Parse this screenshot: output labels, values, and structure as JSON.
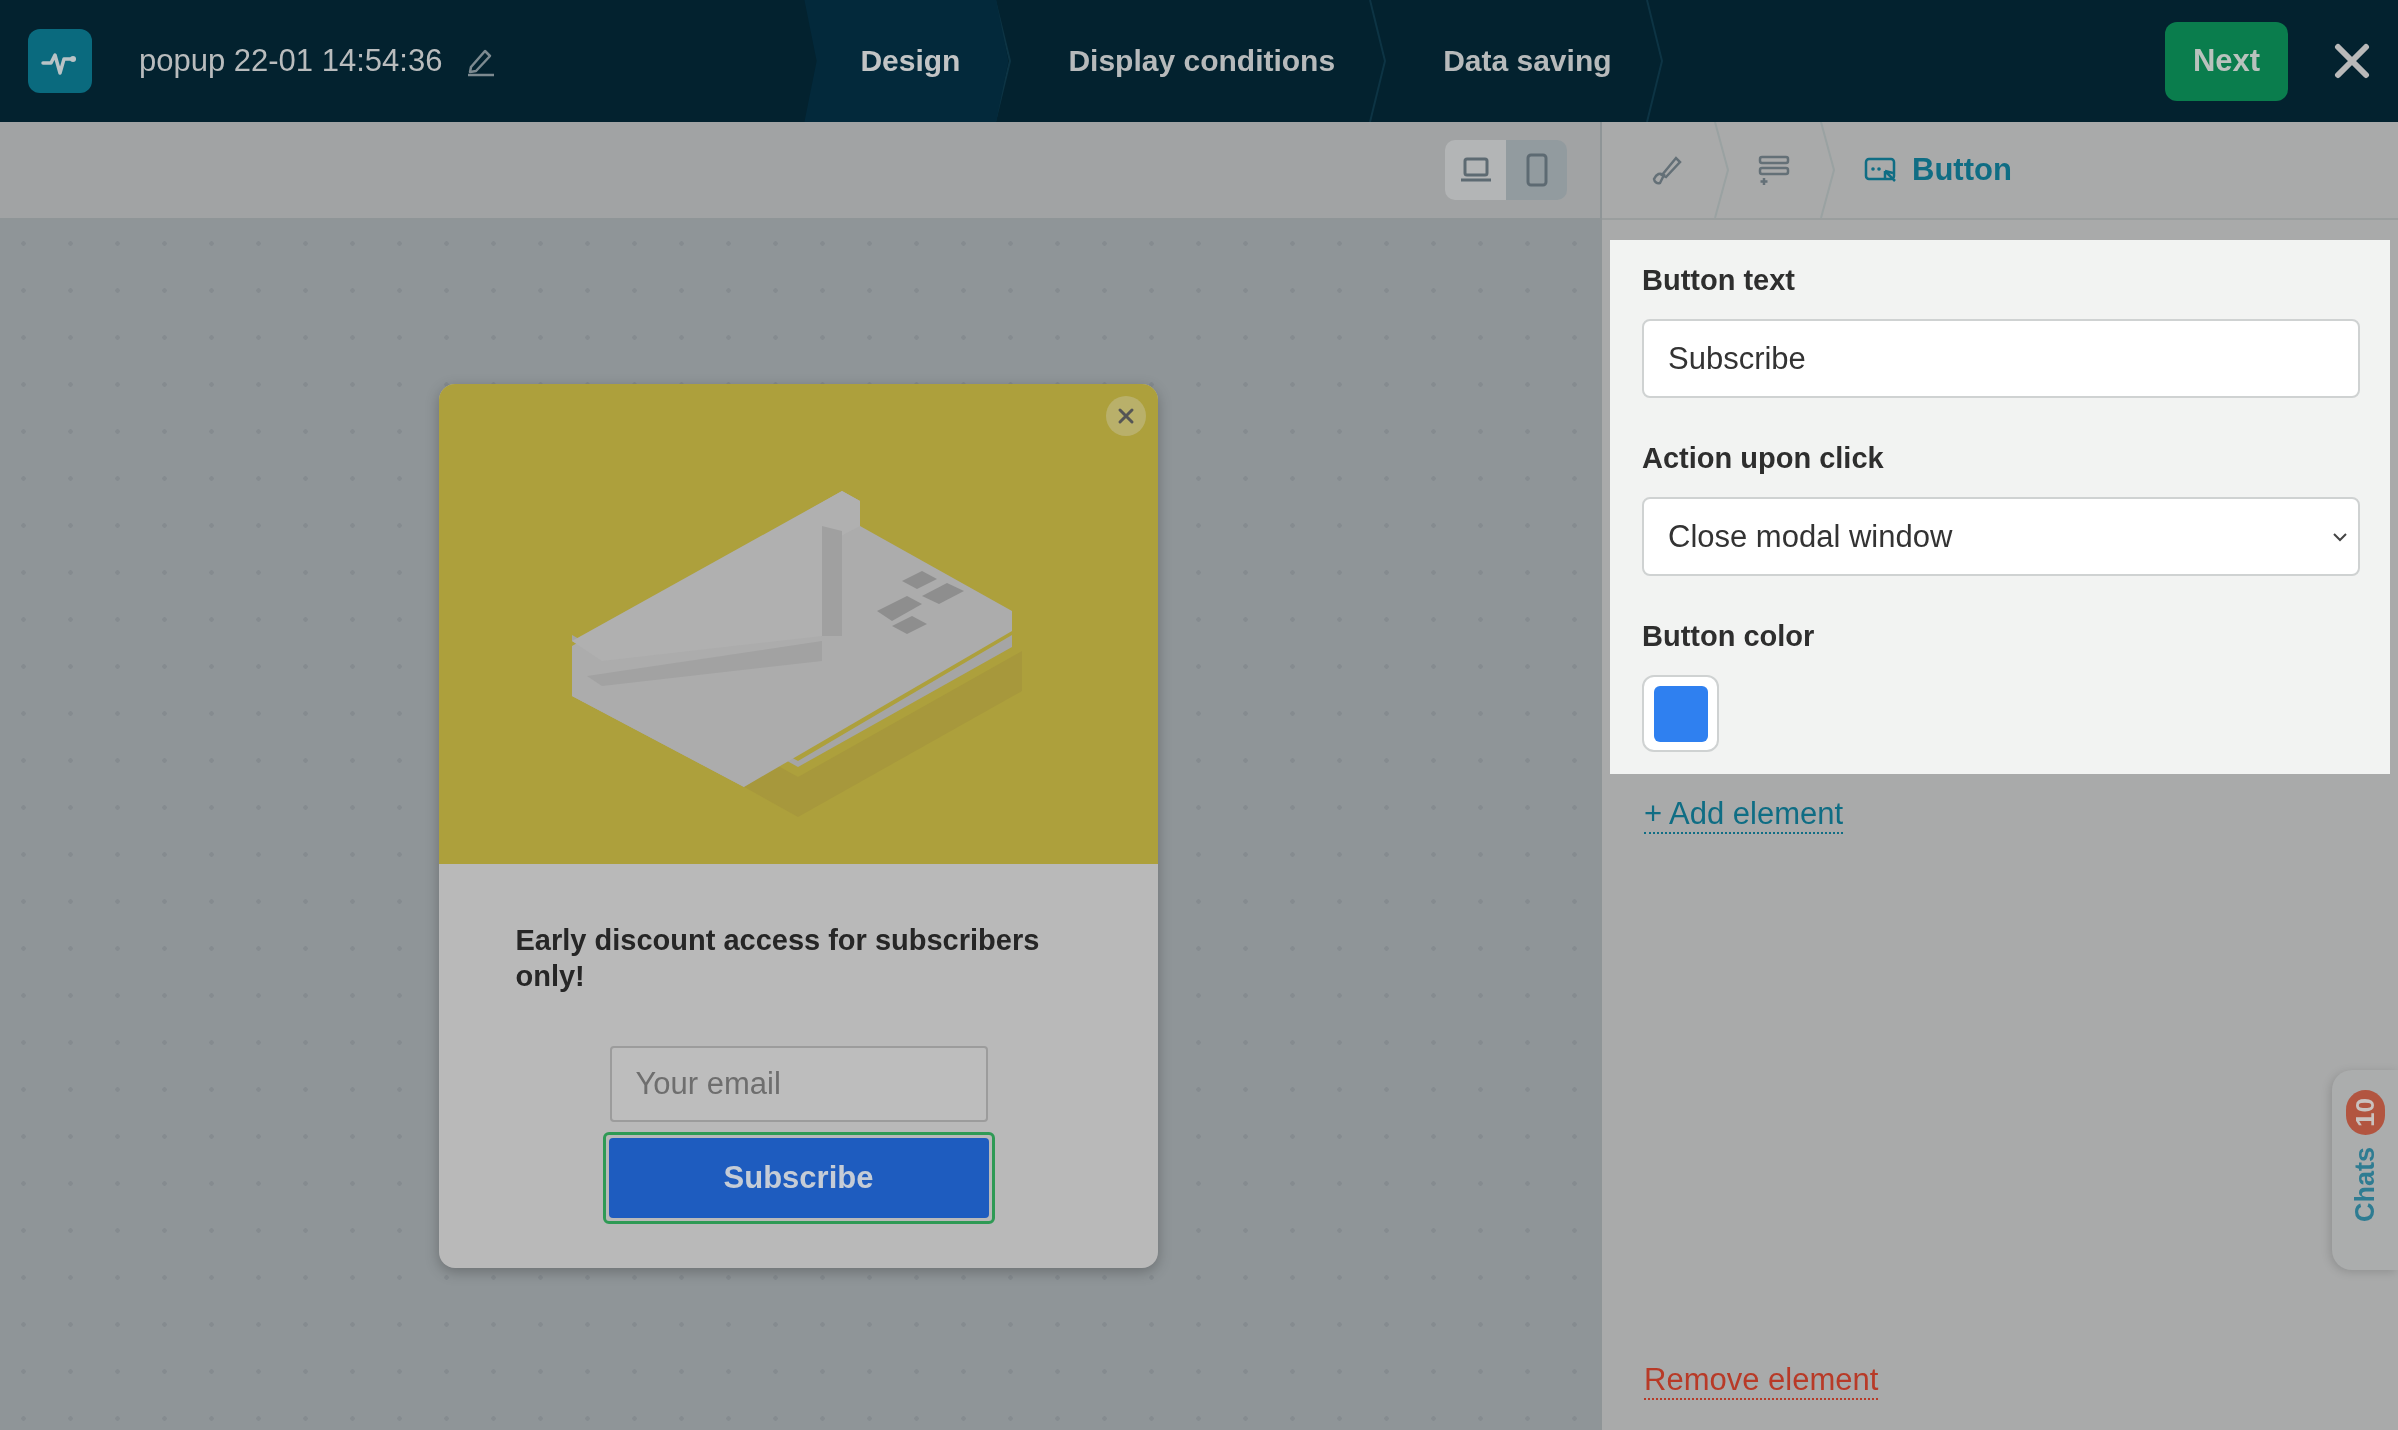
{
  "header": {
    "title": "popup 22-01 14:54:36",
    "tabs": [
      {
        "label": "Design",
        "selected": true
      },
      {
        "label": "Display conditions",
        "selected": false
      },
      {
        "label": "Data saving",
        "selected": false
      }
    ],
    "next_button": "Next"
  },
  "toolbar": {
    "devices": [
      {
        "kind": "desktop",
        "selected": true
      },
      {
        "kind": "mobile",
        "selected": false
      }
    ]
  },
  "breadcrumbs": [
    {
      "kind": "style",
      "selected": false
    },
    {
      "kind": "layout",
      "selected": false
    },
    {
      "kind": "button",
      "label": "Button",
      "selected": true
    }
  ],
  "popup": {
    "heading": "Early discount access for subscribers only!",
    "email_placeholder": "Your email",
    "subscribe_button": "Subscribe"
  },
  "settings": {
    "fields": [
      {
        "kind": "text",
        "label": "Button text",
        "value": "Subscribe"
      },
      {
        "kind": "select",
        "label": "Action upon click",
        "value": "Close modal window"
      },
      {
        "kind": "color",
        "label": "Button color",
        "color": "#2f80f0"
      }
    ],
    "add_element": "+ Add element",
    "remove_element": "Remove element"
  },
  "chats": {
    "label": "Chats",
    "badge": "10"
  }
}
